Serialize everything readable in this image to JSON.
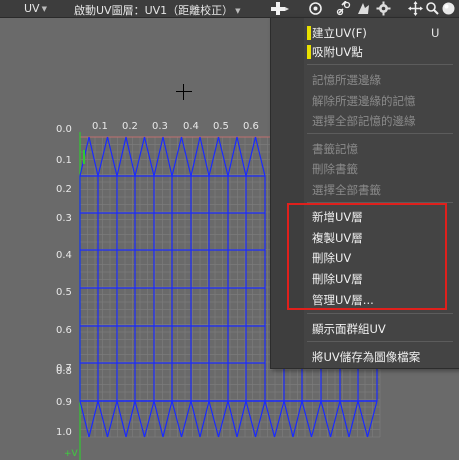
{
  "toolbar": {
    "uv_menu": "UV",
    "mode_label": "啟動UV圖層：UV1（距離校正）",
    "icons": [
      "brush-tool-icon",
      "target-icon",
      "link-icon",
      "transform-icon",
      "gear-icon",
      "move-icon",
      "search-icon",
      "sphere-icon"
    ]
  },
  "axis": {
    "u_ticks": [
      "0.0",
      "0.1",
      "0.2",
      "0.3",
      "0.4",
      "0.5",
      "0.6"
    ],
    "v_ticks": [
      "0.1",
      "0.2",
      "0.3",
      "0.4",
      "0.5",
      "0.6",
      "0.7",
      "0.8",
      "0.9",
      "1.0"
    ],
    "v_axis_label": "+V"
  },
  "menu": {
    "items": [
      {
        "label": "建立UV(F)",
        "shortcut": "U",
        "enabled": true,
        "marker": true
      },
      {
        "label": "吸附UV點",
        "enabled": true,
        "marker": true
      },
      {
        "label": "記憶所選邊緣",
        "enabled": false
      },
      {
        "label": "解除所選邊緣的記憶",
        "enabled": false
      },
      {
        "label": "選擇全部記憶的邊緣",
        "enabled": false
      },
      {
        "label": "書籤記憶",
        "enabled": false
      },
      {
        "label": "刪除書籤",
        "enabled": false
      },
      {
        "label": "選擇全部書籤",
        "enabled": false
      },
      {
        "label": "新增UV層",
        "enabled": true
      },
      {
        "label": "複製UV層",
        "enabled": true
      },
      {
        "label": "刪除UV",
        "enabled": true
      },
      {
        "label": "刪除UV層",
        "enabled": true
      },
      {
        "label": "管理UV層...",
        "enabled": true
      },
      {
        "label": "顯示面群組UV",
        "enabled": true
      },
      {
        "label": "將UV儲存為圖像檔案",
        "enabled": true
      }
    ]
  },
  "colors": {
    "mesh_line": "#1a2aff",
    "highlight": "#e0201c",
    "marker": "#e8e000"
  }
}
